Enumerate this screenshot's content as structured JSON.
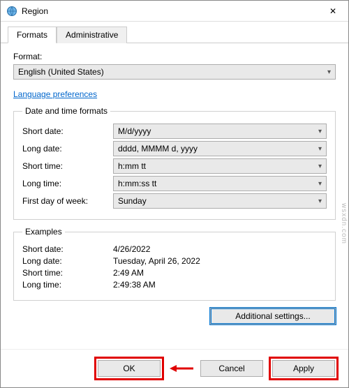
{
  "window": {
    "title": "Region",
    "close_label": "✕"
  },
  "tabs": {
    "formats": "Formats",
    "administrative": "Administrative"
  },
  "format_section": {
    "label": "Format:",
    "value": "English (United States)"
  },
  "link": {
    "language_preferences": "Language preferences"
  },
  "datetime_formats": {
    "legend": "Date and time formats",
    "short_date_label": "Short date:",
    "short_date_value": "M/d/yyyy",
    "long_date_label": "Long date:",
    "long_date_value": "dddd, MMMM d, yyyy",
    "short_time_label": "Short time:",
    "short_time_value": "h:mm tt",
    "long_time_label": "Long time:",
    "long_time_value": "h:mm:ss tt",
    "first_day_label": "First day of week:",
    "first_day_value": "Sunday"
  },
  "examples": {
    "legend": "Examples",
    "short_date_label": "Short date:",
    "short_date_value": "4/26/2022",
    "long_date_label": "Long date:",
    "long_date_value": "Tuesday, April 26, 2022",
    "short_time_label": "Short time:",
    "short_time_value": "2:49 AM",
    "long_time_label": "Long time:",
    "long_time_value": "2:49:38 AM"
  },
  "buttons": {
    "additional_settings": "Additional settings...",
    "ok": "OK",
    "cancel": "Cancel",
    "apply": "Apply"
  },
  "watermark": "wsxdn.com"
}
